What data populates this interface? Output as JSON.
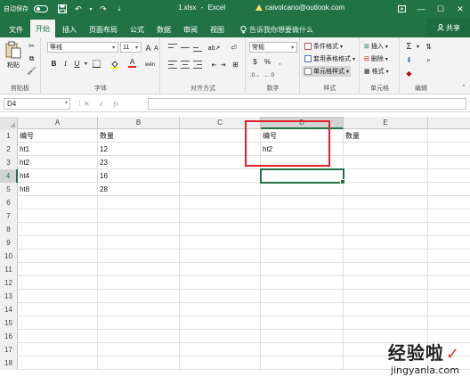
{
  "titlebar": {
    "autosave_label": "自动保存",
    "autosave_state": "●",
    "filename": "1.xlsx",
    "separator": "-",
    "app": "Excel",
    "account": "caivolcano@outlook.com"
  },
  "tabs": [
    "文件",
    "开始",
    "插入",
    "页面布局",
    "公式",
    "数据",
    "审阅",
    "视图"
  ],
  "tellme": "告诉我你想要做什么",
  "share": "共享",
  "ribbon": {
    "clipboard": {
      "label": "剪贴板",
      "paste": "粘贴"
    },
    "font": {
      "label": "字体",
      "font_name": "等线",
      "font_size": "11",
      "bold": "B",
      "italic": "I",
      "underline": "U",
      "grow": "A",
      "shrink": "A",
      "fontcolor": "A",
      "wen": "wén"
    },
    "alignment": {
      "label": "对齐方式"
    },
    "number": {
      "label": "数字",
      "format": "常规",
      "percent": "%",
      "comma": ","
    },
    "styles": {
      "label": "样式",
      "conditional": "条件格式",
      "table": "套用表格格式",
      "cell": "单元格样式"
    },
    "cells": {
      "label": "单元格",
      "insert": "插入",
      "delete": "删除",
      "format": "格式"
    },
    "editing": {
      "label": "编辑",
      "sum": "Σ"
    }
  },
  "formula_bar": {
    "name_box": "D4",
    "fx": "fx",
    "cancel": "✕",
    "enter": "✓",
    "value": ""
  },
  "columns": [
    "A",
    "B",
    "C",
    "D",
    "E"
  ],
  "selected_column": "D",
  "rows": [
    {
      "num": "1",
      "A": "编号",
      "B": "数量",
      "C": "",
      "D": "编号",
      "E": "数量"
    },
    {
      "num": "2",
      "A": "ht1",
      "B": "12",
      "C": "",
      "D": "ht2",
      "E": ""
    },
    {
      "num": "3",
      "A": "ht2",
      "B": "23",
      "C": "",
      "D": "",
      "E": ""
    },
    {
      "num": "4",
      "A": "ht4",
      "B": "16",
      "C": "",
      "D": "",
      "E": ""
    },
    {
      "num": "5",
      "A": "ht8",
      "B": "28",
      "C": "",
      "D": "",
      "E": ""
    },
    {
      "num": "6",
      "A": "",
      "B": "",
      "C": "",
      "D": "",
      "E": ""
    },
    {
      "num": "7",
      "A": "",
      "B": "",
      "C": "",
      "D": "",
      "E": ""
    },
    {
      "num": "8",
      "A": "",
      "B": "",
      "C": "",
      "D": "",
      "E": ""
    },
    {
      "num": "9",
      "A": "",
      "B": "",
      "C": "",
      "D": "",
      "E": ""
    },
    {
      "num": "10",
      "A": "",
      "B": "",
      "C": "",
      "D": "",
      "E": ""
    },
    {
      "num": "11",
      "A": "",
      "B": "",
      "C": "",
      "D": "",
      "E": ""
    },
    {
      "num": "12",
      "A": "",
      "B": "",
      "C": "",
      "D": "",
      "E": ""
    },
    {
      "num": "13",
      "A": "",
      "B": "",
      "C": "",
      "D": "",
      "E": ""
    },
    {
      "num": "14",
      "A": "",
      "B": "",
      "C": "",
      "D": "",
      "E": ""
    },
    {
      "num": "15",
      "A": "",
      "B": "",
      "C": "",
      "D": "",
      "E": ""
    },
    {
      "num": "16",
      "A": "",
      "B": "",
      "C": "",
      "D": "",
      "E": ""
    },
    {
      "num": "17",
      "A": "",
      "B": "",
      "C": "",
      "D": "",
      "E": ""
    },
    {
      "num": "18",
      "A": "",
      "B": "",
      "C": "",
      "D": "",
      "E": ""
    }
  ],
  "active_cell": "D4",
  "watermark": {
    "main": "经验啦",
    "check": "✓",
    "sub": "jingyanla.com"
  },
  "colors": {
    "excel_green": "#217346",
    "highlight_red": "#e2202a"
  }
}
